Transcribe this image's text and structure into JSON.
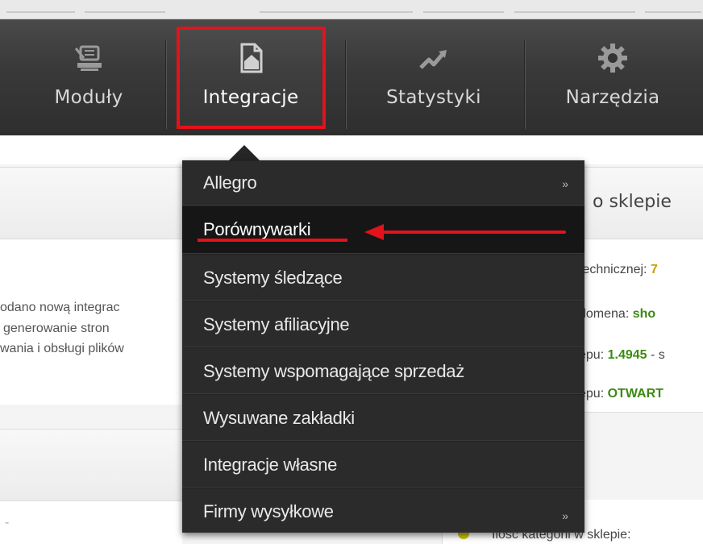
{
  "nav": {
    "items": [
      {
        "label": "Moduły",
        "icon": "modules-icon"
      },
      {
        "label": "Integracje",
        "icon": "integration-icon",
        "active": true
      },
      {
        "label": "Statystyki",
        "icon": "chart-trend-icon"
      },
      {
        "label": "Narzędzia",
        "icon": "gear-icon"
      }
    ]
  },
  "dropdown": {
    "items": [
      {
        "label": "Allegro",
        "submenu": "»"
      },
      {
        "label": "Porównywarki"
      },
      {
        "label": "Systemy śledzące"
      },
      {
        "label": "Systemy afiliacyjne"
      },
      {
        "label": "Systemy wspomagające sprzedaż"
      },
      {
        "label": "Wysuwane zakładki"
      },
      {
        "label": "Integracje własne"
      },
      {
        "label": "Firmy wysyłkowe",
        "submenu": "»"
      }
    ]
  },
  "left_panel": {
    "lines": [
      "odano nową integrac",
      "generowanie stron",
      "wania i obsługi plików"
    ],
    "bottom_fragment": "-"
  },
  "right_panel": {
    "title": "o sklepie",
    "line1_label": "technicznej:",
    "line1_value": "7",
    "line2_label": "domena:",
    "line2_value": "sho",
    "line3_label": "epu:",
    "line3_value": "1.4945",
    "line3_suffix": "- s",
    "line4_label": "epu:",
    "line4_value": "OTWART",
    "bottom_text": "Ilość kategorii w sklepie:"
  },
  "colors": {
    "highlight": "#e3121b",
    "navbar": "#333333",
    "menu": "#2b2b2b",
    "green_value": "#3c8a12"
  }
}
